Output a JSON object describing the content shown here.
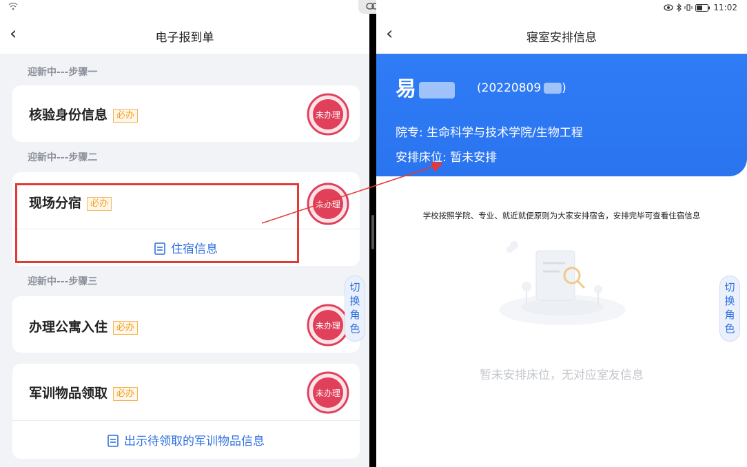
{
  "left": {
    "title": "电子报到单",
    "back_glyph": "‹",
    "steps": [
      {
        "label": "迎新中---步骤一"
      },
      {
        "label": "迎新中---步骤二"
      },
      {
        "label": "迎新中---步骤三"
      }
    ],
    "cards": [
      {
        "title": "核验身份信息",
        "badge": "必办",
        "status": "未办理"
      },
      {
        "title": "现场分宿",
        "badge": "必办",
        "status": "未办理",
        "link": "住宿信息"
      },
      {
        "title": "办理公寓入住",
        "badge": "必办",
        "status": "未办理"
      },
      {
        "title": "军训物品领取",
        "badge": "必办",
        "status": "未办理",
        "link": "出示待领取的军训物品信息"
      }
    ],
    "switch_role": [
      "切",
      "换",
      "角",
      "色"
    ]
  },
  "right": {
    "status_time": "11:02",
    "title": "寝室安排信息",
    "back_glyph": "‹",
    "name": "易",
    "student_id": "(20220809",
    "student_id_end": ")",
    "college_label": "院专:",
    "college_value": "生命科学与技术学院/生物工程",
    "bed_label": "安排床位:",
    "bed_value": "暂未安排",
    "notice": "学校按照学院、专业、就近就便原则为大家安排宿舍，安排完毕可查看住宿信息",
    "empty_text": "暂未安排床位，无对应室友信息",
    "switch_role": [
      "切",
      "换",
      "角",
      "色"
    ]
  },
  "colors": {
    "primary": "#2f7cf6",
    "badge": "#f39a1e",
    "stamp": "#e0405a",
    "highlight": "#e53935"
  }
}
